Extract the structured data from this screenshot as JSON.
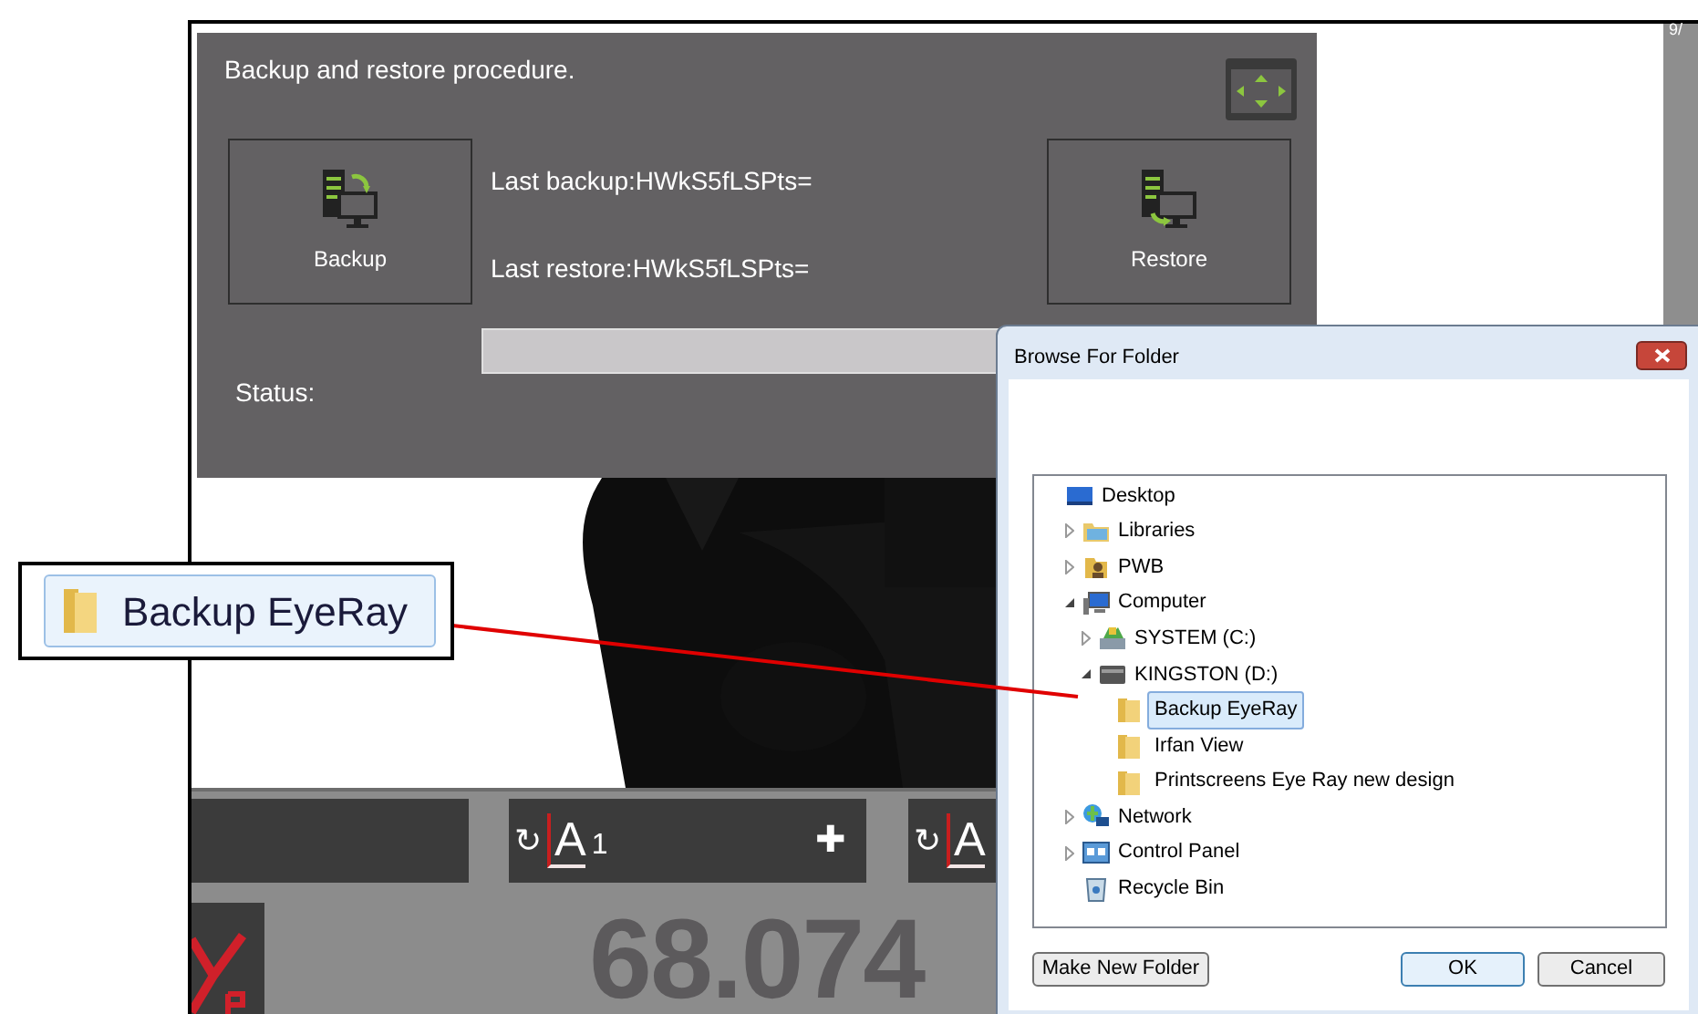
{
  "corner_text": "9/",
  "panel": {
    "title": "Backup and restore procedure.",
    "buttons": [
      {
        "label": "Backup",
        "kind": "backup"
      },
      {
        "label": "Restore",
        "kind": "restore"
      }
    ],
    "last_backup": "Last backup:HWkS5fLSPts=",
    "last_restore": "Last restore:HWkS5fLSPts=",
    "status_label": "Status:",
    "progress": {
      "level": 1
    }
  },
  "toolbar": [
    {
      "rotate": "↻",
      "letter": "A",
      "index": "1",
      "add": "✚"
    },
    {
      "rotate": "↻",
      "letter": "A"
    }
  ],
  "reading": "68.074",
  "dialog": {
    "title": "Browse For Folder",
    "tree": [
      {
        "label": "Desktop",
        "kind": "desktop",
        "selected": false,
        "children": [
          {
            "label": "Libraries",
            "kind": "libraries",
            "expanded": false,
            "selected": false
          },
          {
            "label": "PWB",
            "kind": "user",
            "expanded": false,
            "selected": false
          },
          {
            "label": "Computer",
            "kind": "computer",
            "expanded": true,
            "selected": false,
            "children": [
              {
                "label": "SYSTEM (C:)",
                "kind": "system-drive",
                "expanded": false,
                "selected": false
              },
              {
                "label": "KINGSTON (D:)",
                "kind": "drive",
                "expanded": true,
                "selected": false,
                "children": [
                  {
                    "label": "Backup EyeRay",
                    "kind": "folder",
                    "selected": true
                  },
                  {
                    "label": "Irfan View",
                    "kind": "folder",
                    "selected": false
                  },
                  {
                    "label": "Printscreens Eye Ray new design",
                    "kind": "folder",
                    "selected": false
                  }
                ]
              }
            ]
          },
          {
            "label": "Network",
            "kind": "network",
            "expanded": false,
            "selected": false
          },
          {
            "label": "Control Panel",
            "kind": "control-panel",
            "expanded": false,
            "selected": false
          },
          {
            "label": "Recycle Bin",
            "kind": "recycle-bin",
            "selected": false
          }
        ]
      }
    ],
    "buttons": [
      {
        "label": "Make New Folder",
        "kind": "default"
      },
      {
        "label": "OK",
        "kind": "primary"
      },
      {
        "label": "Cancel",
        "kind": "default"
      }
    ]
  },
  "callout": {
    "label": "Backup EyeRay"
  }
}
